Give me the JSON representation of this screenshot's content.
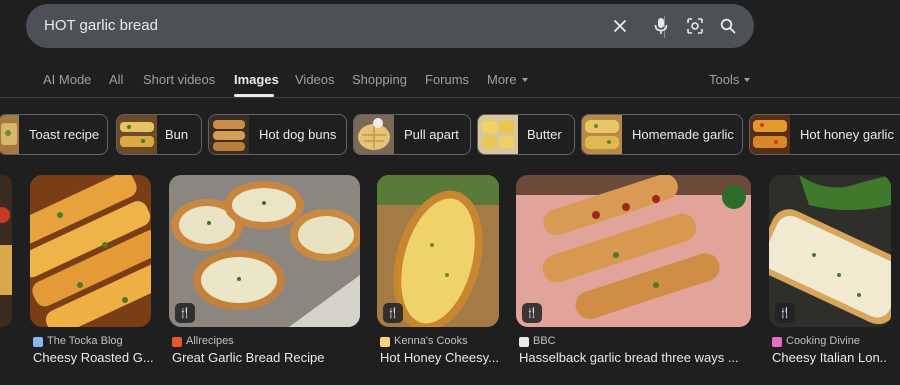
{
  "search": {
    "query": "HOT garlic bread"
  },
  "tabs": [
    {
      "label": "AI Mode"
    },
    {
      "label": "All"
    },
    {
      "label": "Short videos"
    },
    {
      "label": "Images"
    },
    {
      "label": "Videos"
    },
    {
      "label": "Shopping"
    },
    {
      "label": "Forums"
    },
    {
      "label": "More"
    }
  ],
  "tools_label": "Tools",
  "active_tab": "Images",
  "chips": [
    {
      "label": "Toast recipe"
    },
    {
      "label": "Bun"
    },
    {
      "label": "Hot dog buns"
    },
    {
      "label": "Pull apart"
    },
    {
      "label": "Butter"
    },
    {
      "label": "Homemade garlic"
    },
    {
      "label": "Hot honey garlic"
    }
  ],
  "results": [
    {
      "source": "The Tocka Blog",
      "title": "Cheesy Roasted G..."
    },
    {
      "source": "Allrecipes",
      "title": "Great Garlic Bread Recipe"
    },
    {
      "source": "Kenna's Cooks",
      "title": "Hot Honey Cheesy..."
    },
    {
      "source": "BBC",
      "title": "Hasselback garlic bread three ways ..."
    },
    {
      "source": "Cooking Divine",
      "title": "Cheesy Italian Lon..."
    }
  ],
  "colors": {
    "background": "#1f1f1f",
    "searchbar": "#4d5156",
    "text": "#e8eaed",
    "muted": "#9aa0a6"
  },
  "icons": [
    "clear-icon",
    "microphone-icon",
    "lens-camera-icon",
    "search-icon",
    "recipe-badge-icon"
  ]
}
